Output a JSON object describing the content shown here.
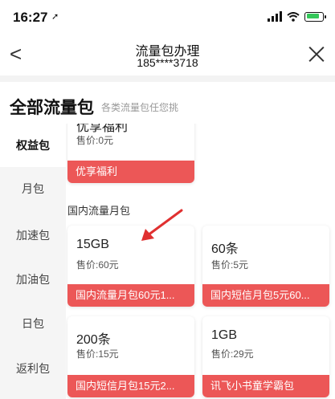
{
  "status": {
    "time": "16:27",
    "location_glyph": "➚"
  },
  "nav": {
    "back_glyph": "<",
    "title": "流量包办理",
    "phone": "185****3718"
  },
  "header": {
    "title": "全部流量包",
    "subtitle": "各类流量包任您挑"
  },
  "sidebar": {
    "items": [
      {
        "label": "权益包",
        "active": true
      },
      {
        "label": "月包"
      },
      {
        "label": "加速包"
      },
      {
        "label": "加油包"
      },
      {
        "label": "日包"
      },
      {
        "label": "返利包"
      }
    ]
  },
  "top_card": {
    "name": "优享福利",
    "price": "售价:0元",
    "band": "优享福利"
  },
  "section": {
    "title": "国内流量月包"
  },
  "cards": [
    {
      "name": "15GB",
      "price": "售价:60元",
      "band": "国内流量月包60元1..."
    },
    {
      "name": "60条",
      "price": "售价:5元",
      "band": "国内短信月包5元60..."
    },
    {
      "name": "200条",
      "price": "售价:15元",
      "band": "国内短信月包15元2..."
    },
    {
      "name": "1GB",
      "price": "售价:29元",
      "band": "讯飞小书童学霸包"
    }
  ],
  "colors": {
    "band": "#ec5757",
    "arrow": "#e03030"
  }
}
